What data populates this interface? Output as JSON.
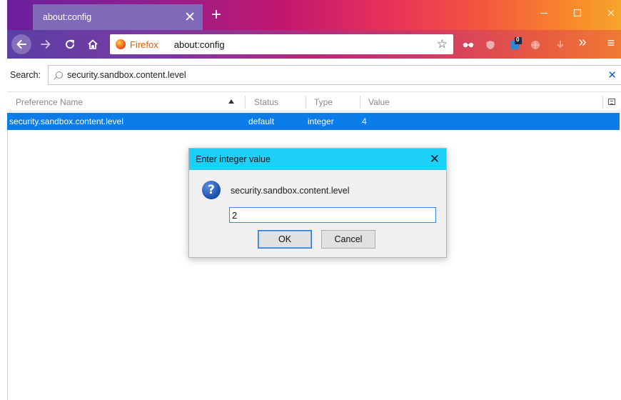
{
  "browser": {
    "tab_title": "about:config",
    "tab_close_glyph": "✕",
    "new_tab_glyph": "+",
    "identity_label": "Firefox",
    "url": "about:config",
    "overflow_glyph": "»",
    "menu_glyph": "≡",
    "badge_count": "0"
  },
  "search": {
    "label": "Search:",
    "value": "security.sandbox.content.level",
    "clear_glyph": "✕"
  },
  "columns": {
    "name": "Preference Name",
    "status": "Status",
    "type": "Type",
    "value": "Value"
  },
  "rows": [
    {
      "name": "security.sandbox.content.level",
      "status": "default",
      "type": "integer",
      "value": "4"
    }
  ],
  "dialog": {
    "title": "Enter integer value",
    "close_glyph": "✕",
    "message": "security.sandbox.content.level",
    "input_value": "2",
    "ok_label": "OK",
    "cancel_label": "Cancel",
    "icon_glyph": "?"
  },
  "colors": {
    "selection": "#0b7ce8",
    "dialog_title": "#1ed0f7",
    "firefox_brand": "#e66000"
  }
}
